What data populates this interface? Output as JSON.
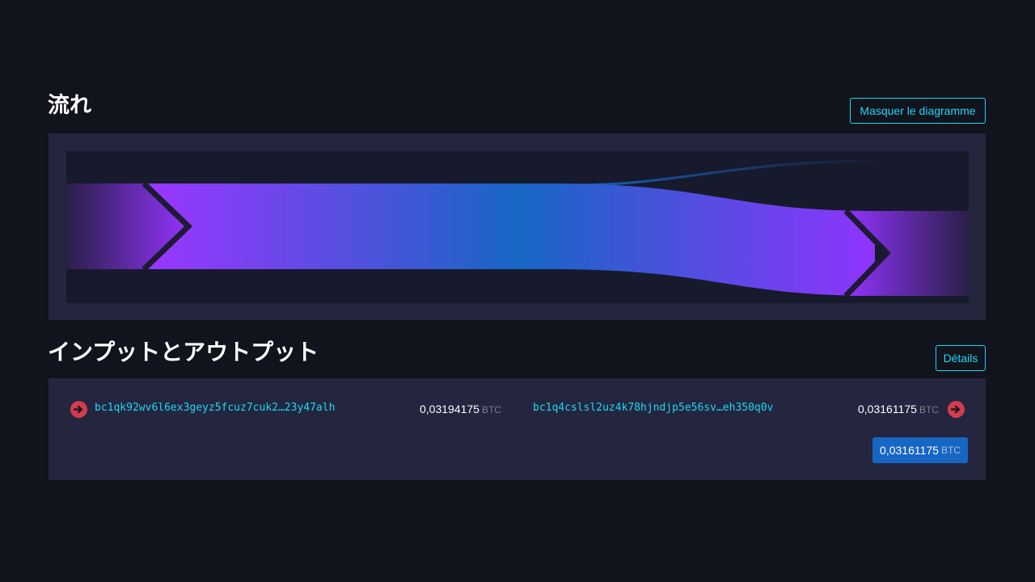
{
  "flow": {
    "title": "流れ",
    "hide_button_label": "Masquer le diagramme",
    "colors": {
      "accent_purple": "#9333ff",
      "accent_blue": "#1766c4",
      "change_line": "#1766c4",
      "panel_bg": "#24253e",
      "inner_bg": "#171a2c"
    }
  },
  "io": {
    "title": "インプットとアウトプット",
    "details_button_label": "Détails",
    "input": {
      "icon": "arrow-right-circle-icon",
      "address": "bc1qk92wv6l6ex3geyz5fcuz7cuk2…23y47alh",
      "amount": "0,03194175",
      "unit": "BTC"
    },
    "output": {
      "icon": "arrow-right-circle-icon",
      "address": "bc1q4cslsl2uz4k78hjndjp5e56sv…eh350q0v",
      "amount": "0,03161175",
      "unit": "BTC"
    },
    "total": {
      "amount": "0,03161175",
      "unit": "BTC"
    }
  }
}
